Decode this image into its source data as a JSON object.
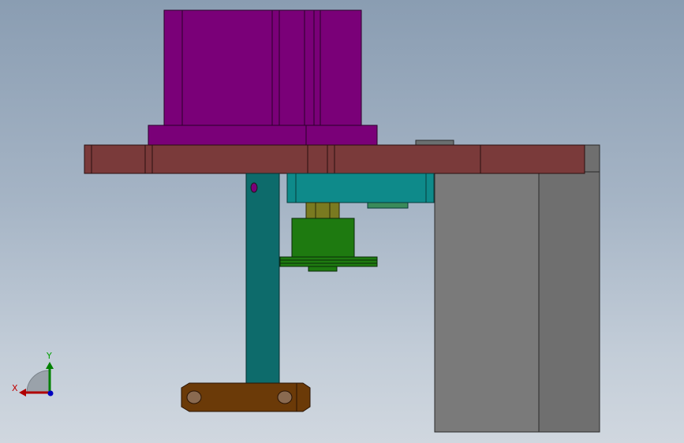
{
  "viewport": {
    "background_top": "#8a9db2",
    "background_bottom": "#d0d7df"
  },
  "parts": {
    "motor_color": "#7a0078",
    "base_plate_color": "#7a3a3a",
    "gearbox_color": "#0e8a8a",
    "shaft_color": "#0d6b6b",
    "pulley_color": "#1e7a10",
    "coupling_color": "#7a7a20",
    "housing_color": "#7a7a7a",
    "link_arm_color": "#6b3a08"
  },
  "triad": {
    "x_label": "X",
    "y_label": "Y",
    "x_color": "#b00000",
    "y_color": "#008000",
    "z_color": "#0000c0"
  }
}
